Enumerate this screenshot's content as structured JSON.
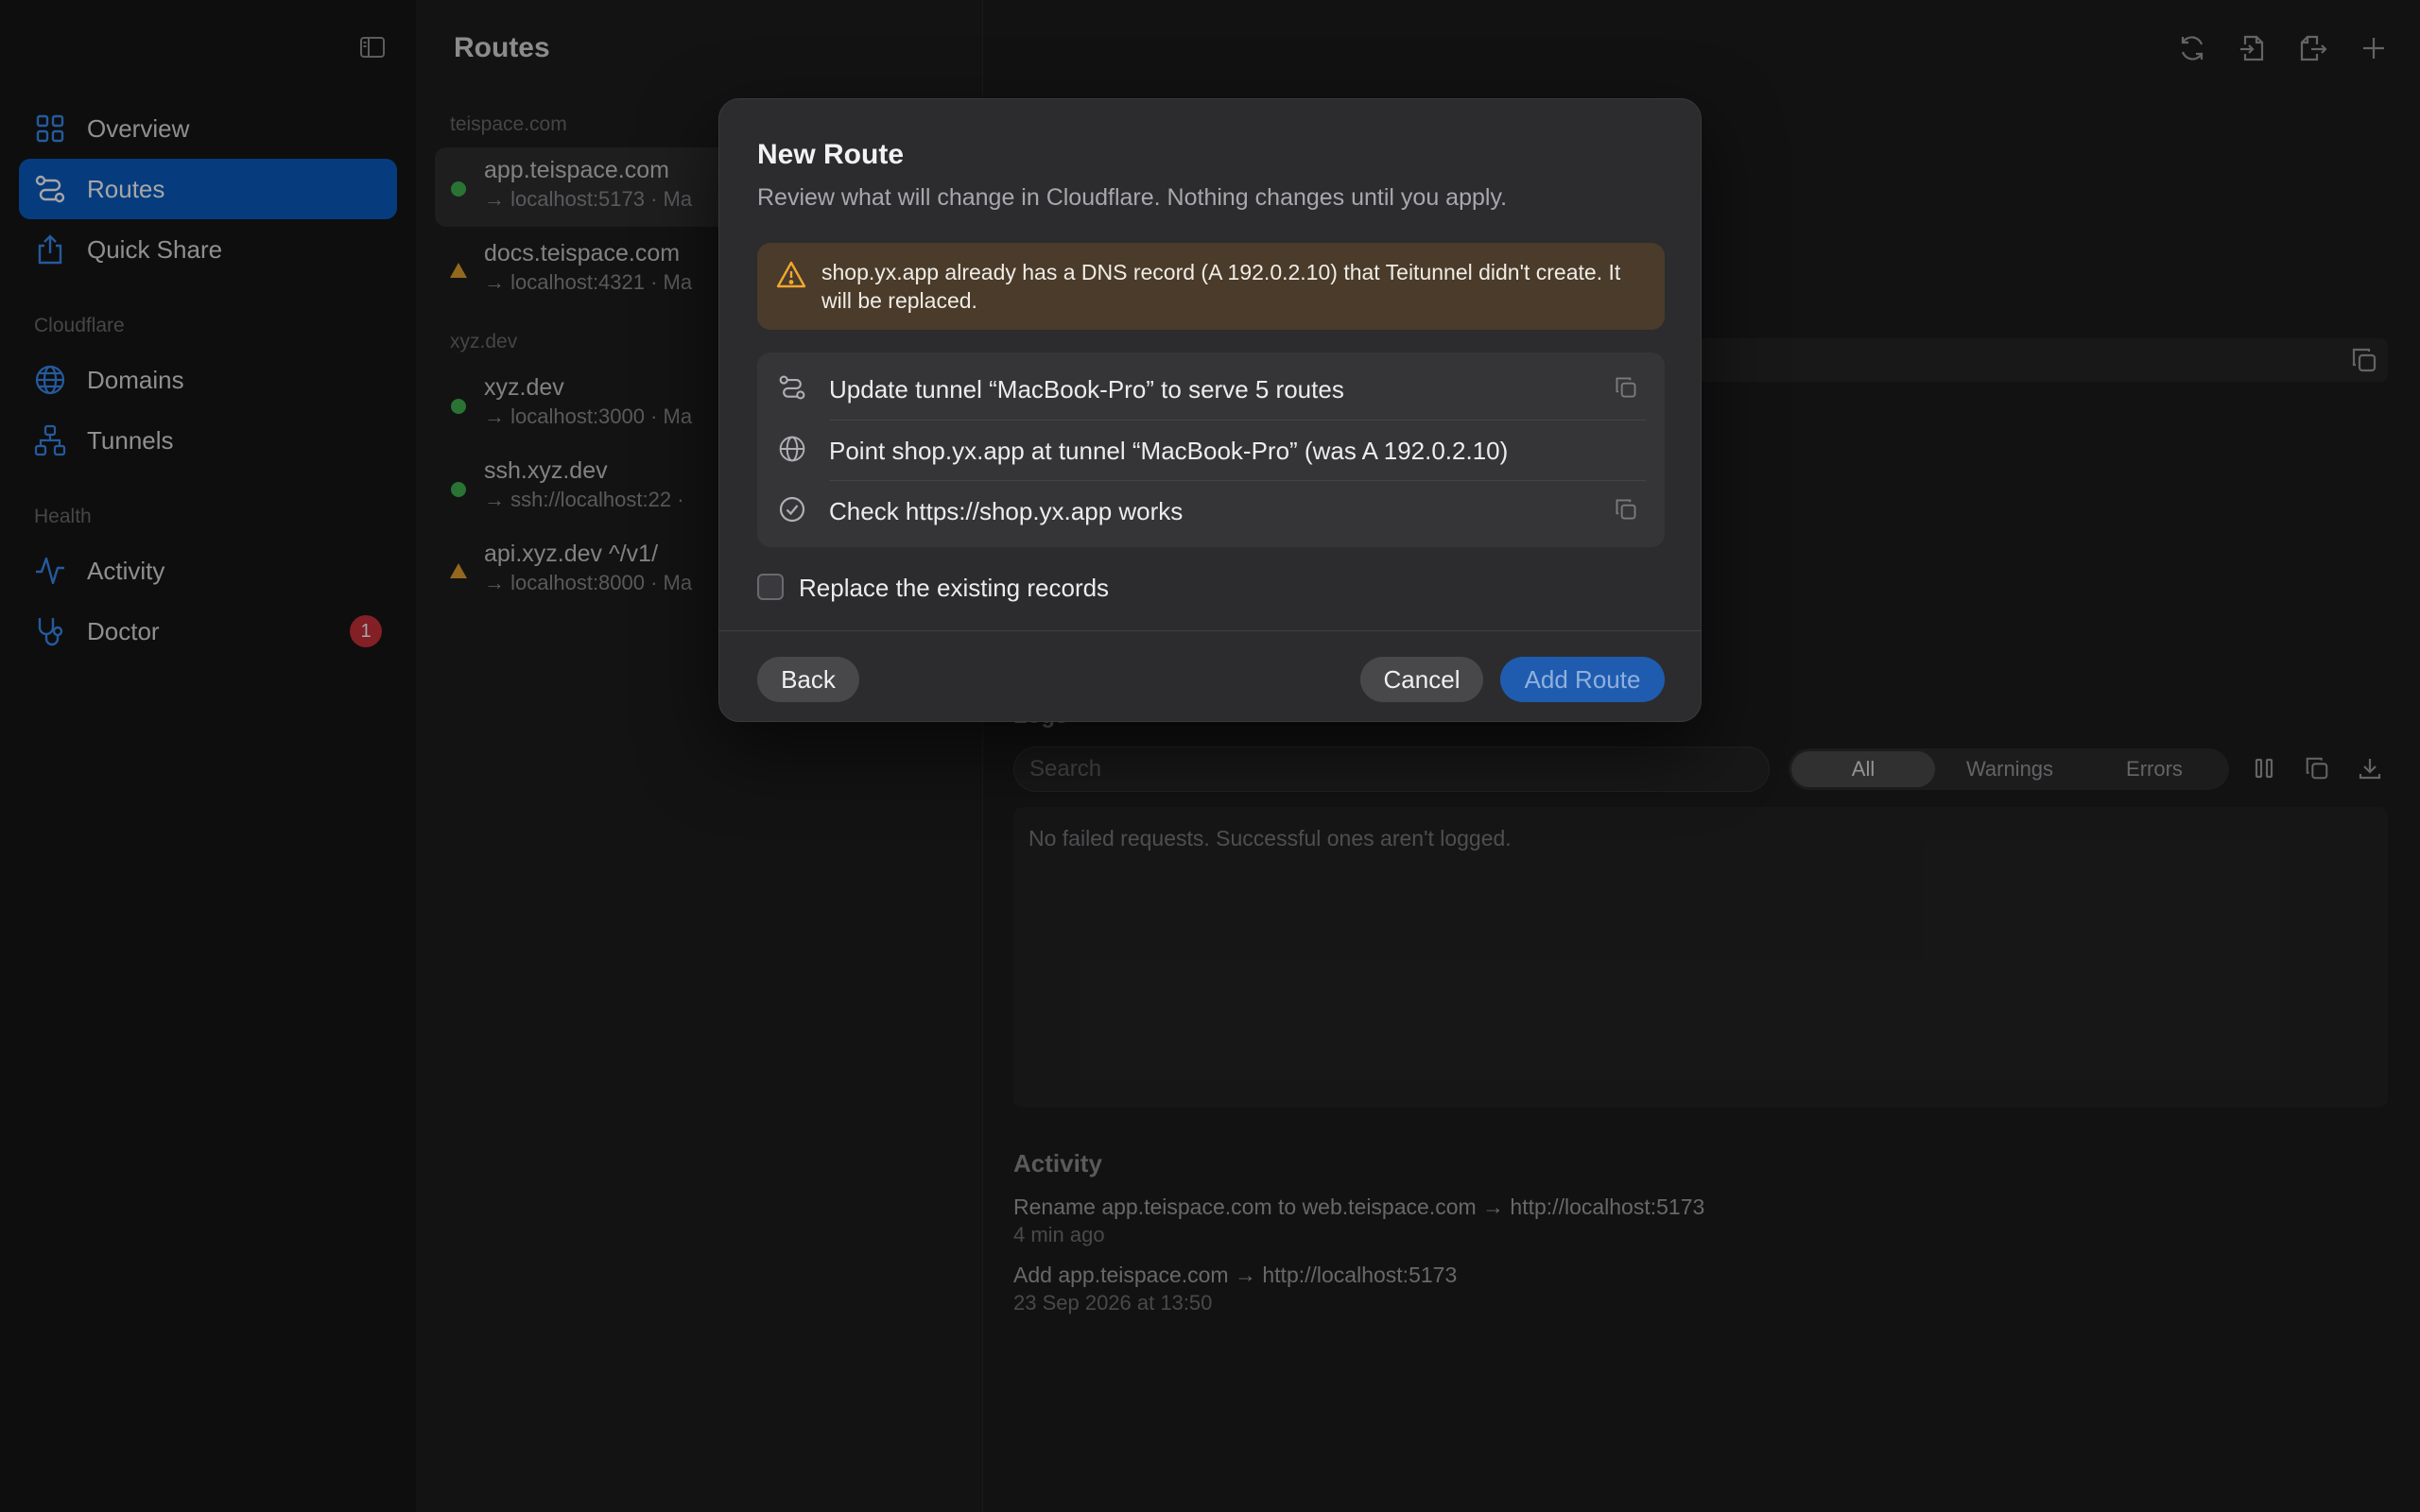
{
  "sidebar": {
    "items_top": [
      {
        "label": "Overview",
        "icon": "grid-icon"
      },
      {
        "label": "Routes",
        "icon": "routes-icon",
        "active": true
      },
      {
        "label": "Quick Share",
        "icon": "share-icon"
      }
    ],
    "cloudflare_heading": "Cloudflare",
    "items_cloudflare": [
      {
        "label": "Domains",
        "icon": "globe-icon"
      },
      {
        "label": "Tunnels",
        "icon": "network-icon"
      }
    ],
    "health_heading": "Health",
    "items_health": [
      {
        "label": "Activity",
        "icon": "pulse-icon"
      },
      {
        "label": "Doctor",
        "icon": "stethoscope-icon",
        "badge": "1"
      }
    ]
  },
  "routes": {
    "title": "Routes",
    "groups": [
      {
        "name": "teispace.com",
        "items": [
          {
            "host": "app.teispace.com",
            "dest": "→ localhost:5173 · Ma",
            "status": "ok"
          },
          {
            "host": "docs.teispace.com",
            "dest": "→ localhost:4321 · Ma",
            "status": "warning"
          }
        ]
      },
      {
        "name": "xyz.dev",
        "items": [
          {
            "host": "xyz.dev",
            "dest": "→ localhost:3000 · Ma",
            "status": "ok"
          },
          {
            "host": "ssh.xyz.dev",
            "dest": "→ ssh://localhost:22 ·",
            "status": "ok"
          },
          {
            "host": "api.xyz.dev ^/v1/",
            "dest": "→ localhost:8000 · Ma",
            "status": "warning"
          }
        ]
      }
    ]
  },
  "detail": {
    "logs_heading": "Logs",
    "search_placeholder": "Search",
    "filters": [
      "All",
      "Warnings",
      "Errors"
    ],
    "empty_logs": "No failed requests. Successful ones aren't logged.",
    "activity_heading": "Activity",
    "activity": [
      {
        "title": "Rename app.teispace.com to web.teispace.com → http://localhost:5173",
        "time": "4 min ago"
      },
      {
        "title": "Add app.teispace.com → http://localhost:5173",
        "time": "23 Sep 2026 at 13:50"
      }
    ]
  },
  "modal": {
    "title": "New Route",
    "subtitle": "Review what will change in Cloudflare. Nothing changes until you apply.",
    "warning": "shop.yx.app already has a DNS record (A 192.0.2.10) that Teitunnel didn't create. It will be replaced.",
    "steps": [
      {
        "text": "Update tunnel “MacBook-Pro” to serve 5 routes",
        "icon": "routes-icon",
        "copy": true
      },
      {
        "text": "Point shop.yx.app at tunnel “MacBook-Pro” (was A 192.0.2.10)",
        "icon": "globe-icon",
        "copy": false
      },
      {
        "text": "Check https://shop.yx.app works",
        "icon": "check-circle-icon",
        "copy": true
      }
    ],
    "checkbox_label": "Replace the existing records",
    "checkbox_checked": false,
    "back_label": "Back",
    "cancel_label": "Cancel",
    "add_label": "Add Route"
  },
  "colors": {
    "accent": "#0a5cc2",
    "icon_blue": "#3a8bf2",
    "ok": "#3fb34f",
    "warning": "#e0a030",
    "badge": "#c8323a"
  }
}
